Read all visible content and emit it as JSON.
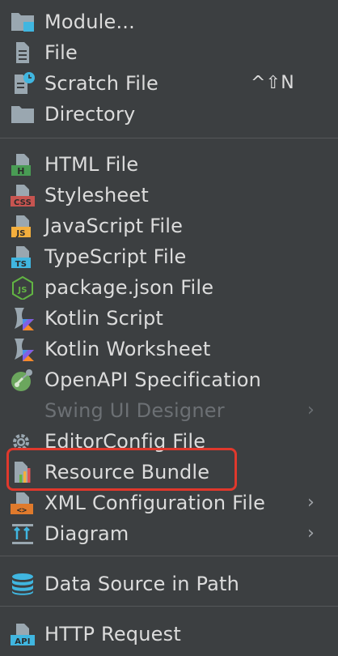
{
  "menu": {
    "items": [
      {
        "label": "Module...",
        "icon": "module-icon"
      },
      {
        "label": "File",
        "icon": "file-icon"
      },
      {
        "label": "Scratch File",
        "icon": "scratch-file-icon",
        "shortcut": "^⇧N"
      },
      {
        "label": "Directory",
        "icon": "folder-icon"
      },
      {
        "label": "HTML File",
        "icon": "html-file-icon",
        "badge": "H"
      },
      {
        "label": "Stylesheet",
        "icon": "css-file-icon",
        "badge": "CSS"
      },
      {
        "label": "JavaScript File",
        "icon": "js-file-icon",
        "badge": "JS"
      },
      {
        "label": "TypeScript File",
        "icon": "ts-file-icon",
        "badge": "TS"
      },
      {
        "label": "package.json File",
        "icon": "nodejs-icon",
        "badge": "JS"
      },
      {
        "label": "Kotlin Script",
        "icon": "kotlin-script-icon"
      },
      {
        "label": "Kotlin Worksheet",
        "icon": "kotlin-worksheet-icon"
      },
      {
        "label": "OpenAPI Specification",
        "icon": "openapi-icon"
      },
      {
        "label": "Swing UI Designer",
        "icon": "",
        "disabled": true,
        "submenu": true
      },
      {
        "label": "EditorConfig File",
        "icon": "gear-icon"
      },
      {
        "label": "Resource Bundle",
        "icon": "resource-bundle-icon"
      },
      {
        "label": "XML Configuration File",
        "icon": "xml-file-icon",
        "badge": "<>",
        "submenu": true
      },
      {
        "label": "Diagram",
        "icon": "diagram-icon",
        "submenu": true
      },
      {
        "label": "Data Source in Path",
        "icon": "database-icon"
      },
      {
        "label": "HTTP Request",
        "icon": "http-request-icon",
        "badge": "API"
      }
    ],
    "submenu_arrow": "›"
  },
  "colors": {
    "background": "#3c3f41",
    "text": "#dcdcdc",
    "disabled_text": "#6c7074",
    "separator": "#555759",
    "highlight_border": "#e0382c"
  }
}
